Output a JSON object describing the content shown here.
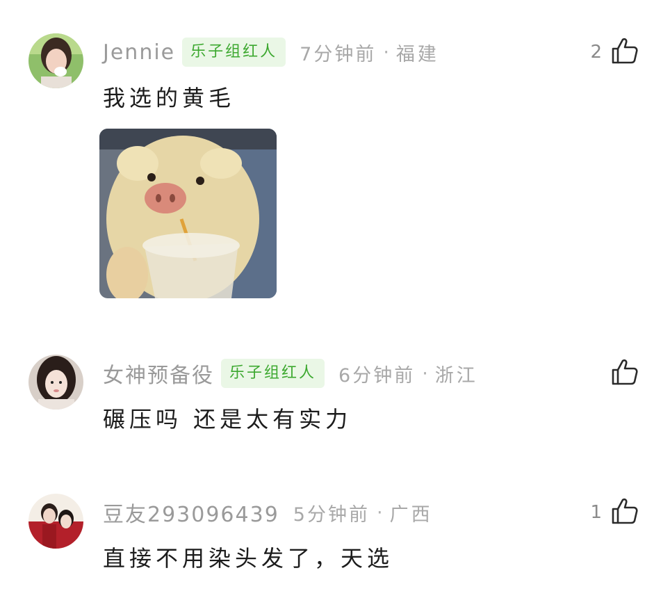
{
  "comments": [
    {
      "username": "Jennie",
      "badge": "乐子组红人",
      "time": "7分钟前",
      "separator": "·",
      "location": "福建",
      "likes": "2",
      "text": "我选的黄毛",
      "image": "pig-drinking-image"
    },
    {
      "username": "女神预备役",
      "badge": "乐子组红人",
      "time": "6分钟前",
      "separator": "·",
      "location": "浙江",
      "likes": "",
      "text": "碾压吗 还是太有实力"
    },
    {
      "username": "豆友293096439",
      "badge": "",
      "time": "5分钟前",
      "separator": "·",
      "location": "广西",
      "likes": "1",
      "text": "直接不用染头发了，天选"
    }
  ],
  "colors": {
    "badge_bg": "#eaf7e6",
    "badge_text": "#3ca82f",
    "meta_text": "#a8a8a8",
    "body_text": "#1c1c1c"
  }
}
